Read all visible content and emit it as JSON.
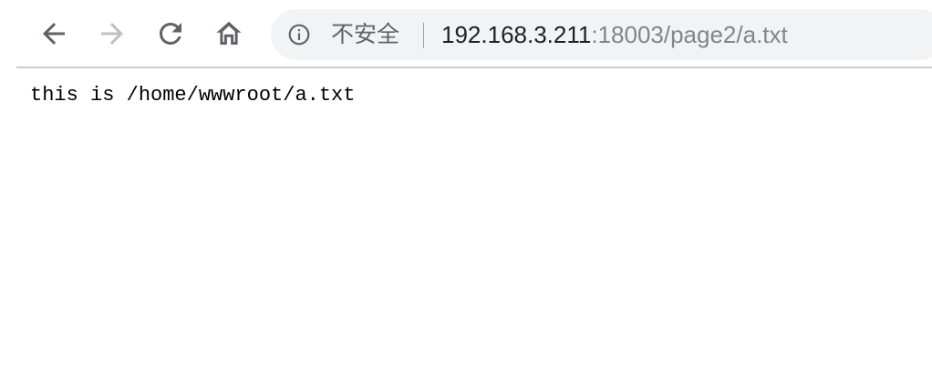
{
  "toolbar": {
    "back_icon": "arrow-left-icon",
    "forward_icon": "arrow-right-icon",
    "reload_icon": "reload-icon",
    "home_icon": "home-icon"
  },
  "omnibox": {
    "info_icon": "info-icon",
    "security_text": "不安全",
    "url_host": "192.168.3.211",
    "url_rest": ":18003/page2/a.txt"
  },
  "page": {
    "text": "this is /home/wwwroot/a.txt"
  },
  "colors": {
    "icon_active": "#5f6368",
    "icon_disabled": "#bdc1c6",
    "omnibox_bg": "#f1f3f4",
    "url_host": "#202124",
    "url_rest": "#80868b"
  }
}
